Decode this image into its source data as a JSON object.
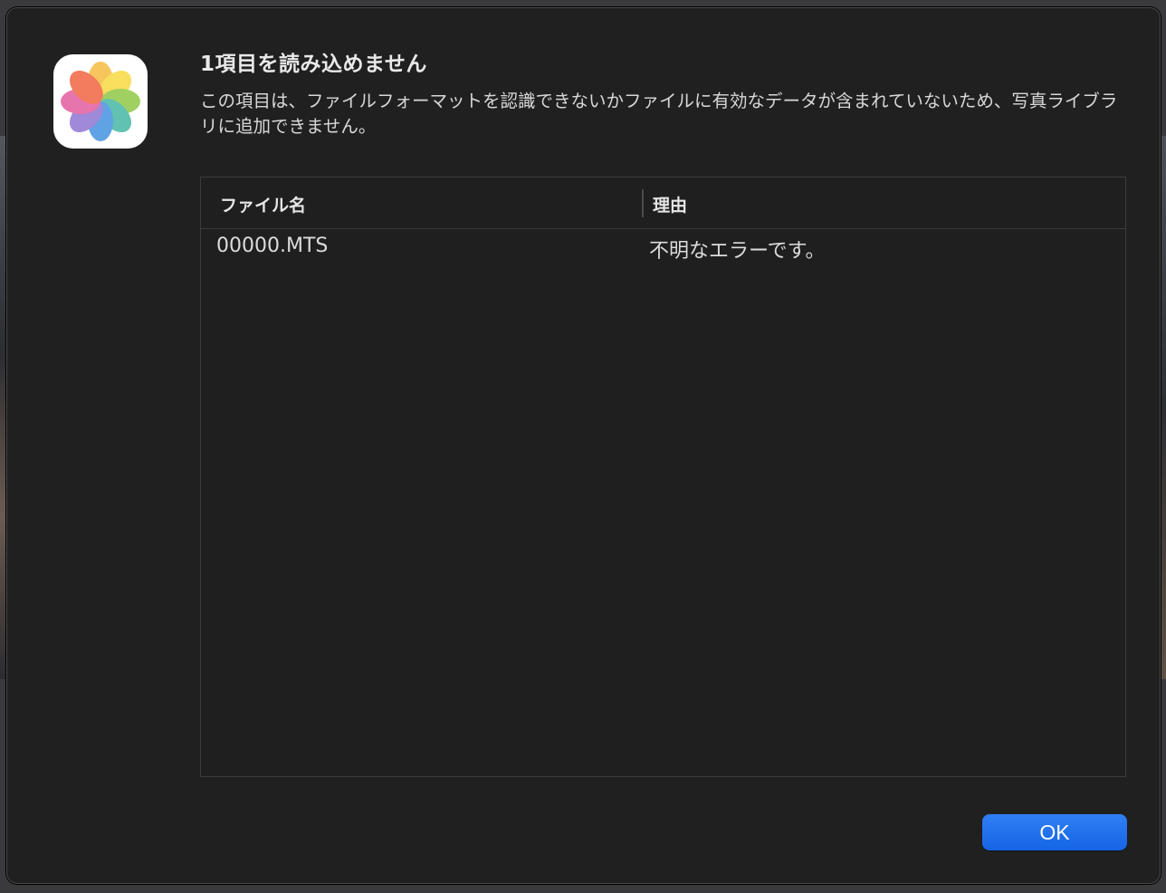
{
  "dialog": {
    "app_icon": "photos-icon",
    "title": "1項目を読み込めません",
    "message": "この項目は、ファイルフォーマットを認識できないかファイルに有効なデータが含まれていないため、写真ライブラリに追加できません。"
  },
  "table": {
    "columns": [
      "ファイル名",
      "理由"
    ],
    "rows": [
      {
        "filename": "00000.MTS",
        "reason": "不明なエラーです。"
      }
    ]
  },
  "buttons": {
    "ok_label": "OK"
  },
  "colors": {
    "dialog_background": "#202020",
    "accent": "#1a6ef0",
    "text_primary": "#e9e9e9"
  }
}
